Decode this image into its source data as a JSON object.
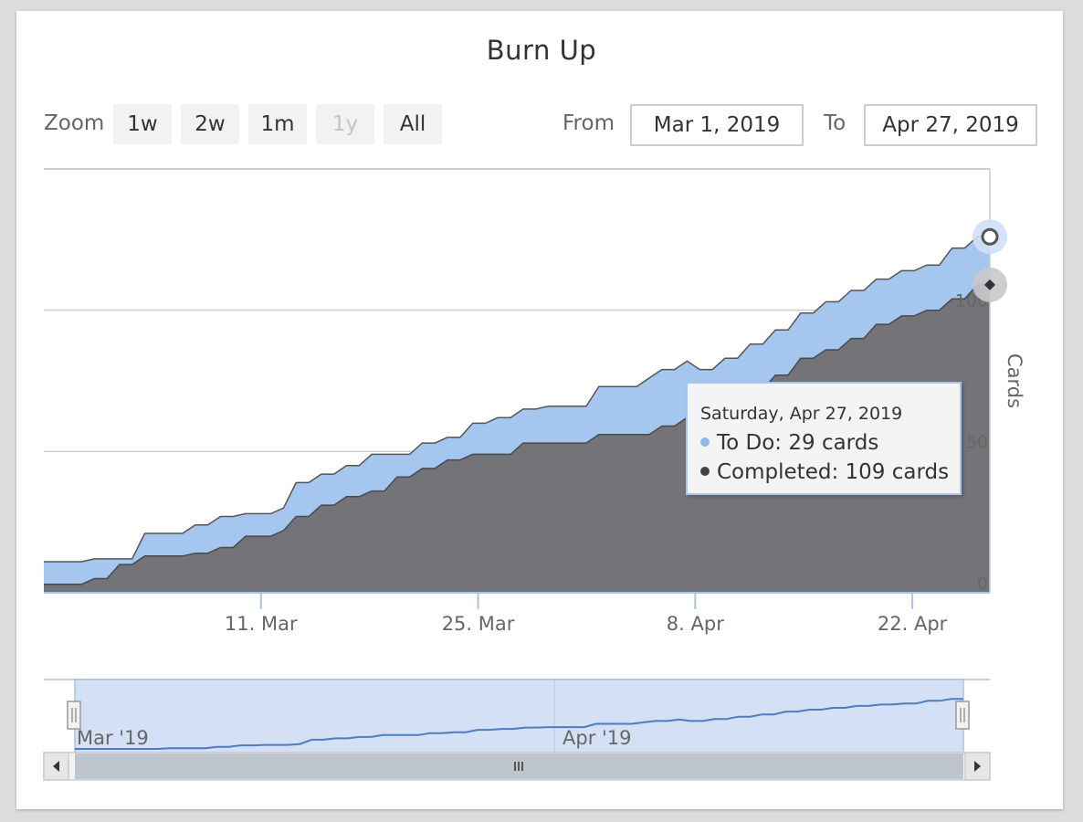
{
  "title": "Burn Up",
  "toolbar": {
    "zoom_label": "Zoom",
    "zoom_buttons": [
      "1w",
      "2w",
      "1m",
      "1y",
      "All"
    ],
    "zoom_disabled": "1y",
    "from_label": "From",
    "from_value": "Mar 1, 2019",
    "to_label": "To",
    "to_value": "Apr 27, 2019"
  },
  "tooltip": {
    "date": "Saturday, Apr 27, 2019",
    "todo_text": "To Do: 29 cards",
    "completed_text": "Completed: 109 cards"
  },
  "navigator": {
    "labels": [
      "Mar '19",
      "Apr '19"
    ]
  },
  "colors": {
    "todo": "#a5c6ee",
    "completed": "#747377",
    "completed_line": "#4a4a4e",
    "navigator_fill": "#d4e0f5",
    "navigator_line": "#4f7cbf"
  },
  "chart_data": {
    "type": "area",
    "stacked": true,
    "title": "Burn Up",
    "xlabel": "",
    "ylabel": "Cards",
    "y_axis_side": "right",
    "ylim": [
      0,
      150
    ],
    "yticks": [
      0,
      50,
      100
    ],
    "xticks": [
      "11. Mar",
      "25. Mar",
      "8. Apr",
      "22. Apr"
    ],
    "x_range": [
      "2019-02-25",
      "2019-04-27"
    ],
    "grid": true,
    "legend": "none",
    "x": [
      "2019-02-25",
      "2019-02-26",
      "2019-02-27",
      "2019-02-28",
      "2019-03-01",
      "2019-03-02",
      "2019-03-03",
      "2019-03-04",
      "2019-03-05",
      "2019-03-06",
      "2019-03-07",
      "2019-03-08",
      "2019-03-09",
      "2019-03-10",
      "2019-03-11",
      "2019-03-12",
      "2019-03-13",
      "2019-03-14",
      "2019-03-15",
      "2019-03-16",
      "2019-03-17",
      "2019-03-18",
      "2019-03-19",
      "2019-03-20",
      "2019-03-21",
      "2019-03-22",
      "2019-03-23",
      "2019-03-24",
      "2019-03-25",
      "2019-03-26",
      "2019-03-27",
      "2019-03-28",
      "2019-03-29",
      "2019-03-30",
      "2019-03-31",
      "2019-04-01",
      "2019-04-02",
      "2019-04-03",
      "2019-04-04",
      "2019-04-05",
      "2019-04-06",
      "2019-04-07",
      "2019-04-08",
      "2019-04-09",
      "2019-04-10",
      "2019-04-11",
      "2019-04-12",
      "2019-04-13",
      "2019-04-14",
      "2019-04-15",
      "2019-04-16",
      "2019-04-17",
      "2019-04-18",
      "2019-04-19",
      "2019-04-20",
      "2019-04-21",
      "2019-04-22",
      "2019-04-23",
      "2019-04-24",
      "2019-04-25",
      "2019-04-26",
      "2019-04-27"
    ],
    "series": [
      {
        "name": "Completed",
        "values": [
          3,
          3,
          3,
          3,
          5,
          5,
          10,
          10,
          13,
          13,
          13,
          13,
          14,
          14,
          16,
          16,
          20,
          20,
          20,
          22,
          27,
          27,
          31,
          31,
          34,
          34,
          36,
          36,
          41,
          41,
          44,
          44,
          47,
          47,
          49,
          49,
          49,
          49,
          53,
          53,
          53,
          53,
          53,
          53,
          56,
          56,
          56,
          56,
          56,
          59,
          59,
          62,
          62,
          62,
          66,
          66,
          72,
          72,
          77,
          77,
          83,
          83,
          86,
          86,
          90,
          90,
          95,
          95,
          98,
          98,
          100,
          100,
          104,
          104,
          109,
          109
        ]
      },
      {
        "name": "To Do",
        "values": [
          8,
          8,
          8,
          8,
          7,
          7,
          2,
          2,
          8,
          8,
          8,
          8,
          10,
          10,
          11,
          11,
          8,
          8,
          8,
          8,
          12,
          12,
          11,
          11,
          11,
          11,
          13,
          13,
          8,
          8,
          9,
          9,
          8,
          8,
          11,
          11,
          13,
          13,
          12,
          12,
          13,
          13,
          13,
          13,
          17,
          17,
          17,
          17,
          20,
          20,
          20,
          20,
          17,
          17,
          17,
          17,
          16,
          16,
          16,
          16,
          16,
          16,
          17,
          17,
          17,
          17,
          16,
          16,
          16,
          16,
          16,
          16,
          18,
          18,
          17,
          17
        ]
      }
    ]
  }
}
